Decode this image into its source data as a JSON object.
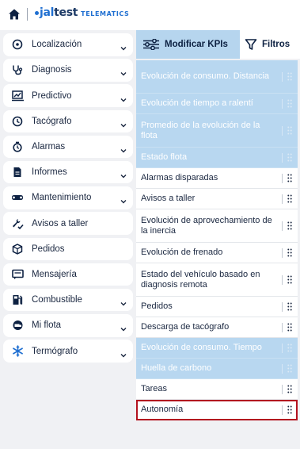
{
  "brand": {
    "logo_prefix": "jal",
    "logo_rest": "test",
    "logo_suffix": "TELEMATICS"
  },
  "colors": {
    "accent": "#1f6fd1",
    "active_row": "#b8d7f0",
    "highlight": "#b3121f",
    "sidebar_bg": "#f0f1f4"
  },
  "sidebar": {
    "items": [
      {
        "label": "Localización",
        "icon": "location-pin-icon",
        "expandable": true
      },
      {
        "label": "Diagnosis",
        "icon": "stethoscope-icon",
        "expandable": true
      },
      {
        "label": "Predictivo",
        "icon": "predictive-chart-icon",
        "expandable": true
      },
      {
        "label": "Tacógrafo",
        "icon": "tachograph-icon",
        "expandable": true
      },
      {
        "label": "Alarmas",
        "icon": "alarm-clock-icon",
        "expandable": true
      },
      {
        "label": "Informes",
        "icon": "document-icon",
        "expandable": true
      },
      {
        "label": "Mantenimiento",
        "icon": "wrench-icon",
        "expandable": true
      },
      {
        "label": "Avisos a taller",
        "icon": "tools-check-icon",
        "expandable": false
      },
      {
        "label": "Pedidos",
        "icon": "package-icon",
        "expandable": false
      },
      {
        "label": "Mensajería",
        "icon": "message-icon",
        "expandable": false
      },
      {
        "label": "Combustible",
        "icon": "fuel-pump-icon",
        "expandable": true
      },
      {
        "label": "Mi flota",
        "icon": "fleet-icon",
        "expandable": true
      },
      {
        "label": "Termógrafo",
        "icon": "snowflake-icon",
        "expandable": true
      }
    ]
  },
  "panel": {
    "tabs": [
      {
        "label": "Modificar KPIs",
        "icon": "sliders-icon",
        "selected": true
      },
      {
        "label": "Filtros",
        "icon": "filter-funnel-icon",
        "selected": false
      }
    ],
    "kpis": [
      {
        "label": "Evolución de consumo. Distancia",
        "active": true
      },
      {
        "label": "Evolución de tiempo a ralentí",
        "active": true
      },
      {
        "label": "Promedio de la evolución de la flota",
        "active": true
      },
      {
        "label": "Estado flota",
        "active": true
      },
      {
        "label": "Alarmas disparadas",
        "active": false
      },
      {
        "label": "Avisos a taller",
        "active": false
      },
      {
        "label": "Evolución de aprovechamiento de la inercia",
        "active": false
      },
      {
        "label": "Evolución de frenado",
        "active": false
      },
      {
        "label": "Estado del vehículo basado en diagnosis remota",
        "active": false
      },
      {
        "label": "Pedidos",
        "active": false
      },
      {
        "label": "Descarga de tacógrafo",
        "active": false
      },
      {
        "label": "Evolución de consumo. Tiempo",
        "active": true
      },
      {
        "label": "Huella de carbono",
        "active": true
      },
      {
        "label": "Tareas",
        "active": false
      },
      {
        "label": "Autonomía",
        "active": false,
        "highlighted": true
      }
    ]
  }
}
